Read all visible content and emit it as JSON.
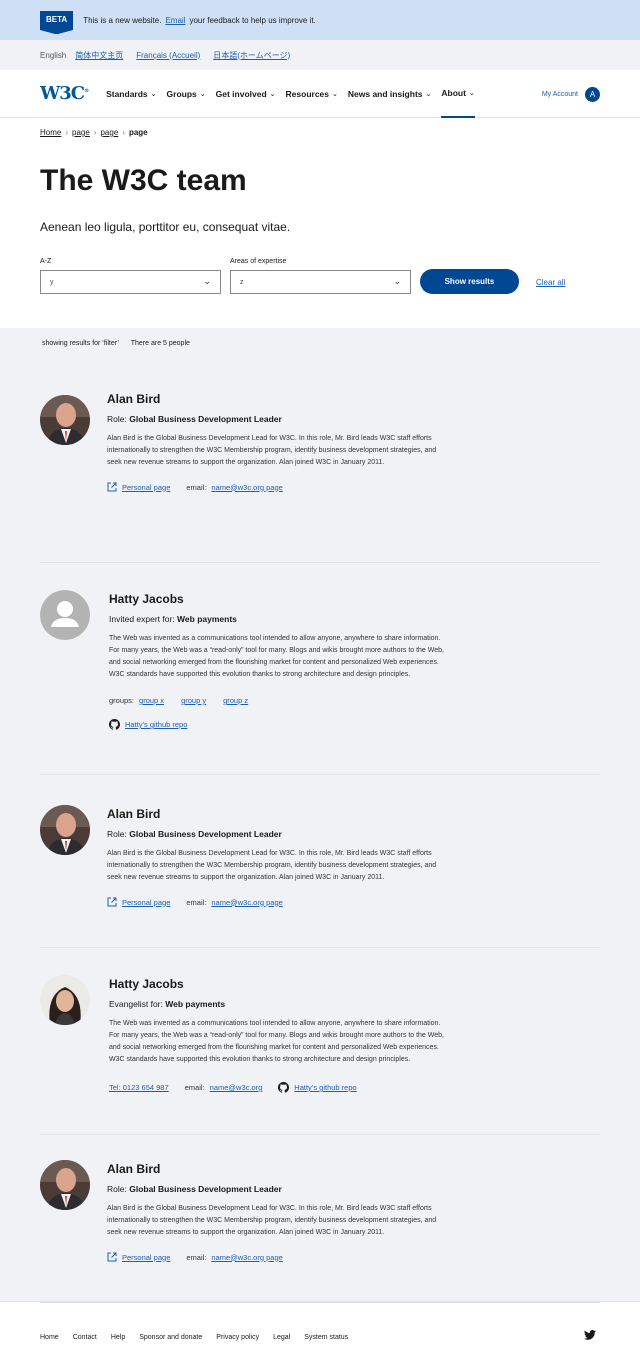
{
  "beta": {
    "badge": "BETA",
    "text_before": "This is a new website.",
    "link": "Email",
    "text_after": "your feedback to help us improve it."
  },
  "languages": {
    "current": "English",
    "links": [
      "简体中文主页",
      "Français (Accueil)",
      "日本語(ホームページ)"
    ]
  },
  "logo": {
    "text": "W3C",
    "mark": "®"
  },
  "nav": {
    "items": [
      "Standards",
      "Groups",
      "Get involved",
      "Resources",
      "News and insights",
      "About"
    ],
    "active": "About",
    "account": "My Account",
    "avatar_letter": "A"
  },
  "breadcrumb": [
    "Home",
    "page",
    "page",
    "page"
  ],
  "page": {
    "title": "The W3C team",
    "intro": "Aenean leo ligula, porttitor eu, consequat vitae."
  },
  "filters": {
    "az_label": "A-Z",
    "az_value": "y",
    "expertise_label": "Areas of expertise",
    "expertise_value": "z",
    "show_button": "Show results",
    "clear_link": "Clear all"
  },
  "results_info": {
    "showing": "showing results for ‘filter’",
    "count": "There are 5 people"
  },
  "people": [
    {
      "name": "Alan Bird",
      "role_label": "Role:",
      "role": "Global Business Development Leader",
      "bio": "Alan Bird is the Global Business Development Lead for W3C. In this role, Mr. Bird leads W3C staff efforts internationally to strengthen the W3C Membership program, identify business development strategies, and seek new revenue streams to support the organization. Alan joined W3C in January 2011.",
      "personal_page": "Personal page",
      "email_label": "email:",
      "email": "name@w3c.org page"
    },
    {
      "name": "Hatty Jacobs",
      "role_label": "Invited expert for:",
      "role": "Web payments",
      "bio": "The Web was invented as a communications tool intended to allow anyone, anywhere to share information. For many years, the Web was a “read-only” tool for many. Blogs and wikis brought more authors to the Web, and social networking emerged from the flourishing market for content and personalized Web experiences. W3C standards have supported this evolution thanks to strong architecture and design principles.",
      "groups_label": "groups:",
      "groups": [
        "group x",
        "group y",
        "group z"
      ],
      "github": "Hatty’s github repo"
    },
    {
      "name": "Alan Bird",
      "role_label": "Role:",
      "role": "Global Business Development Leader",
      "bio": "Alan Bird is the Global Business Development Lead for W3C. In this role, Mr. Bird leads W3C staff efforts internationally to strengthen the W3C Membership program, identify business development strategies, and seek new revenue streams to support the organization. Alan joined W3C in January 2011.",
      "personal_page": "Personal page",
      "email_label": "email:",
      "email": "name@w3c.org page"
    },
    {
      "name": "Hatty Jacobs",
      "role_label": "Evangelist for:",
      "role": "Web payments",
      "bio": "The Web was invented as a communications tool intended to allow anyone, anywhere to share information. For many years, the Web was a “read-only” tool for many. Blogs and wikis brought more authors to the Web, and social networking emerged from the flourishing market for content and personalized Web experiences. W3C standards have supported this evolution thanks to strong architecture and design principles.",
      "tel": "Tel: 0123 654 987",
      "email_label": "email:",
      "email": "name@w3c.org",
      "github": "Hatty’s github repo"
    },
    {
      "name": "Alan Bird",
      "role_label": "Role:",
      "role": "Global Business Development Leader",
      "bio": "Alan Bird is the Global Business Development Lead for W3C. In this role, Mr. Bird leads W3C staff efforts internationally to strengthen the W3C Membership program, identify business development strategies, and seek new revenue streams to support the organization. Alan joined W3C in January 2011.",
      "personal_page": "Personal page",
      "email_label": "email:",
      "email": "name@w3c.org page"
    }
  ],
  "footer": {
    "links": [
      "Home",
      "Contact",
      "Help",
      "Sponsor and donate",
      "Privacy policy",
      "Legal",
      "System status"
    ]
  },
  "colors": {
    "primary": "#004794",
    "beta_bg": "#cfe0f6",
    "results_bg": "#f1f2f5"
  }
}
